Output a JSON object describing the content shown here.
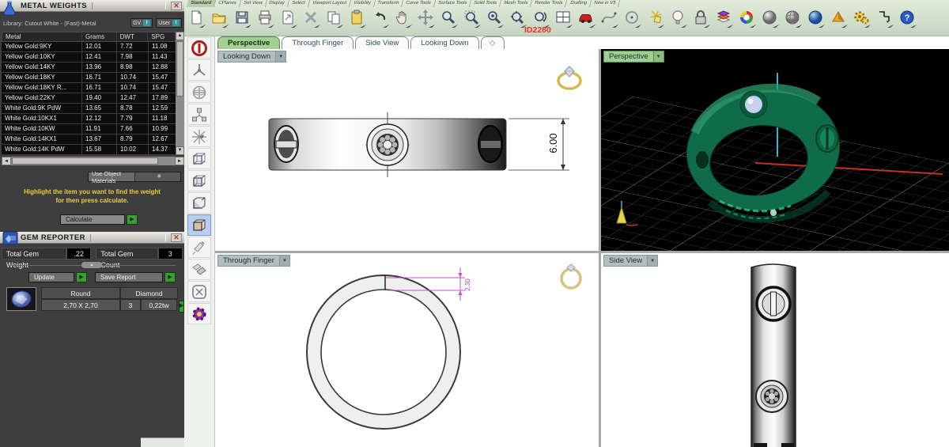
{
  "metal_weights": {
    "title": "METAL WEIGHTS",
    "library": "Library: Cutout White - (Fast)-Metal",
    "gv": "GV",
    "user": "User",
    "toggle_glyph": "I",
    "columns": {
      "metal": "Metal",
      "grams": "Grams",
      "dwt": "DWT",
      "spg": "SPG"
    },
    "rows": [
      {
        "metal": "Yellow Gold:9KY",
        "grams": "12.01",
        "dwt": "7.72",
        "spg": "11.08"
      },
      {
        "metal": "Yellow Gold:10KY",
        "grams": "12.41",
        "dwt": "7.98",
        "spg": "11.43"
      },
      {
        "metal": "Yellow Gold:14KY",
        "grams": "13.96",
        "dwt": "8.98",
        "spg": "12.88"
      },
      {
        "metal": "Yellow Gold:18KY",
        "grams": "16.71",
        "dwt": "10.74",
        "spg": "15.47"
      },
      {
        "metal": "Yellow Gold:18KY R...",
        "grams": "16.71",
        "dwt": "10.74",
        "spg": "15.47"
      },
      {
        "metal": "Yellow Gold:22KY",
        "grams": "19.40",
        "dwt": "12.47",
        "spg": "17.89"
      },
      {
        "metal": "White Gold:9K PdW",
        "grams": "13.65",
        "dwt": "8.78",
        "spg": "12.59"
      },
      {
        "metal": "White Gold:10KX1",
        "grams": "12.12",
        "dwt": "7.79",
        "spg": "11.18"
      },
      {
        "metal": "White Gold:10KW",
        "grams": "11.91",
        "dwt": "7.66",
        "spg": "10.99"
      },
      {
        "metal": "White Gold:14KX1",
        "grams": "13.67",
        "dwt": "8.79",
        "spg": "12.67"
      },
      {
        "metal": "White Gold:14K PdW",
        "grams": "15.58",
        "dwt": "10.02",
        "spg": "14.37"
      }
    ],
    "materials_dropdown": "Use Object Materials",
    "instruction_line1": "Highlight the item you want to find the weight",
    "instruction_line2": "for then press calculate.",
    "calculate": "Calculate"
  },
  "gem_reporter": {
    "title": "GEM REPORTER",
    "total_weight_label": "Total Gem Weight",
    "total_weight_value": ".22",
    "total_count_label": "Total Gem Count",
    "total_count_value": "3",
    "update": "Update",
    "save_report": "Save Report",
    "gem_shape": "Round",
    "gem_type": "Diamond",
    "gem_size": "2,70 X 2,70",
    "gem_count": "3",
    "gem_weight": "0,22tw"
  },
  "toolbar": {
    "tabs": [
      "Standard",
      "CPlanes",
      "Set View",
      "Display",
      "Select",
      "Viewport Layout",
      "Visibility",
      "Transform",
      "Curve Tools",
      "Surface Tools",
      "Solid Tools",
      "Mesh Tools",
      "Render Tools",
      "Drafting",
      "New in V5"
    ],
    "id_label": "ID2280",
    "icons": [
      "new-document",
      "open-folder",
      "save",
      "print",
      "export-page",
      "delete",
      "copy",
      "paste",
      "undo",
      "pan-hand",
      "move",
      "zoom-dynamic",
      "zoom-window",
      "zoom-selected",
      "zoom-extents",
      "rotate-view",
      "viewport-layout",
      "red-car",
      "curve-tool",
      "circle-tool",
      "sparkle",
      "lightbulb",
      "lock",
      "layers",
      "color-wheel",
      "shaded-sphere",
      "ghosted-sphere",
      "rendered-sphere",
      "cone",
      "settings-gears",
      "history-link",
      "help"
    ]
  },
  "viewport_tabs": {
    "t0": "Perspective",
    "t1": "Through Finger",
    "t2": "Side View",
    "t3": "Looking Down"
  },
  "viewports": {
    "top_left": {
      "label": "Looking Down",
      "dimension": "6.00"
    },
    "top_right": {
      "label": "Perspective"
    },
    "bottom_left": {
      "label": "Through Finger",
      "dimension": "2,30"
    },
    "bottom_right": {
      "label": "Side View"
    }
  },
  "side_toolbar": {
    "icons": [
      "record-stop",
      "propeller",
      "globe-snap",
      "molecule",
      "smart-snap",
      "cube-wire-1",
      "cube-wire-2",
      "cube-wire-3",
      "cube-shaded-selected",
      "pour-material",
      "sweep-tool",
      "pattern-square",
      "gear-purple"
    ]
  }
}
